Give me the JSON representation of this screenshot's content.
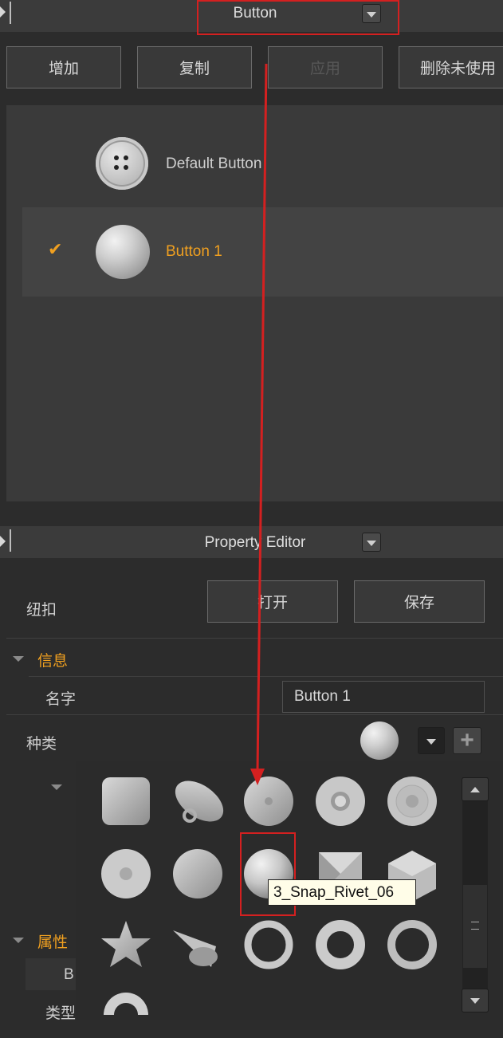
{
  "top_panel": {
    "title": "Button",
    "buttons": [
      "增加",
      "复制",
      "应用",
      "删除未使用"
    ],
    "items": [
      {
        "label": "Default Button",
        "selected": false
      },
      {
        "label": "Button 1",
        "selected": true
      }
    ],
    "check_glyph": "✔"
  },
  "property_editor": {
    "title": "Property Editor",
    "object_label": "纽扣",
    "open_label": "打开",
    "save_label": "保存",
    "info_section": "信息",
    "name_label": "名字",
    "name_value": "Button 1",
    "type_label": "种类",
    "plus_glyph": "+",
    "attr_section": "属性",
    "attr_partial": "B",
    "attr_type_label": "类型"
  },
  "picker": {
    "tooltip": "3_Snap_Rivet_06",
    "shapes": [
      "rounded-square-icon",
      "tilted-snap-icon",
      "snap-rivet-01-icon",
      "snap-ring-icon",
      "snap-rivet-02-icon",
      "snap-rivet-03-icon",
      "flat-disc-icon",
      "snap-rivet-06-icon",
      "pyramid-icon",
      "hexagon-icon",
      "star-icon",
      "cone-icon",
      "ring-01-icon",
      "ring-02-icon",
      "ring-03-icon",
      "half-ring-icon"
    ]
  },
  "colors": {
    "accent": "#f0a020",
    "annotation": "#d42020"
  }
}
